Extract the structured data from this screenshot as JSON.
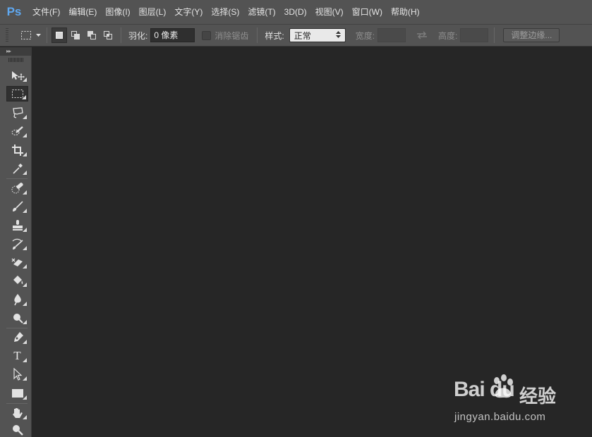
{
  "app": {
    "logo": "Ps"
  },
  "menu": [
    {
      "label": "文件(F)"
    },
    {
      "label": "编辑(E)"
    },
    {
      "label": "图像(I)"
    },
    {
      "label": "图层(L)"
    },
    {
      "label": "文字(Y)"
    },
    {
      "label": "选择(S)"
    },
    {
      "label": "滤镜(T)"
    },
    {
      "label": "3D(D)"
    },
    {
      "label": "视图(V)"
    },
    {
      "label": "窗口(W)"
    },
    {
      "label": "帮助(H)"
    }
  ],
  "options": {
    "feather_label": "羽化:",
    "feather_value": "0 像素",
    "antialias_label": "消除锯齿",
    "style_label": "样式:",
    "style_value": "正常",
    "width_label": "宽度:",
    "height_label": "高度:",
    "refine_edge_button": "调整边缘..."
  },
  "toolbar": {
    "collapse_glyph": "▸▸",
    "tools": [
      {
        "name": "move-tool",
        "icon": "move-icon",
        "active": false
      },
      {
        "name": "rectangular-marquee-tool",
        "icon": "marquee-icon",
        "active": true
      },
      {
        "name": "lasso-tool",
        "icon": "lasso-icon",
        "active": false
      },
      {
        "name": "quick-selection-tool",
        "icon": "quick-selection-icon",
        "active": false
      },
      {
        "name": "crop-tool",
        "icon": "crop-icon",
        "active": false
      },
      {
        "name": "eyedropper-tool",
        "icon": "eyedropper-icon",
        "active": false
      },
      {
        "name": "spot-healing-brush-tool",
        "icon": "healing-icon",
        "active": false
      },
      {
        "name": "brush-tool",
        "icon": "brush-icon",
        "active": false
      },
      {
        "name": "clone-stamp-tool",
        "icon": "stamp-icon",
        "active": false
      },
      {
        "name": "history-brush-tool",
        "icon": "history-brush-icon",
        "active": false
      },
      {
        "name": "eraser-tool",
        "icon": "eraser-icon",
        "active": false
      },
      {
        "name": "paint-bucket-tool",
        "icon": "paint-bucket-icon",
        "active": false
      },
      {
        "name": "blur-tool",
        "icon": "blur-icon",
        "active": false
      },
      {
        "name": "dodge-tool",
        "icon": "dodge-icon",
        "active": false
      },
      {
        "name": "pen-tool",
        "icon": "pen-icon",
        "active": false
      },
      {
        "name": "type-tool",
        "icon": "type-icon",
        "active": false,
        "glyph": "T"
      },
      {
        "name": "path-selection-tool",
        "icon": "path-selection-icon",
        "active": false
      },
      {
        "name": "rectangle-tool",
        "icon": "rectangle-icon",
        "active": false
      },
      {
        "name": "hand-tool",
        "icon": "hand-icon",
        "active": false
      },
      {
        "name": "zoom-tool",
        "icon": "zoom-icon",
        "active": false
      }
    ]
  },
  "watermark": {
    "logo": "Bai du",
    "title": "经验",
    "url": "jingyan.baidu.com"
  },
  "colors": {
    "chrome": "#535353",
    "canvas": "#262626",
    "ps_blue": "#5fa8f0"
  }
}
